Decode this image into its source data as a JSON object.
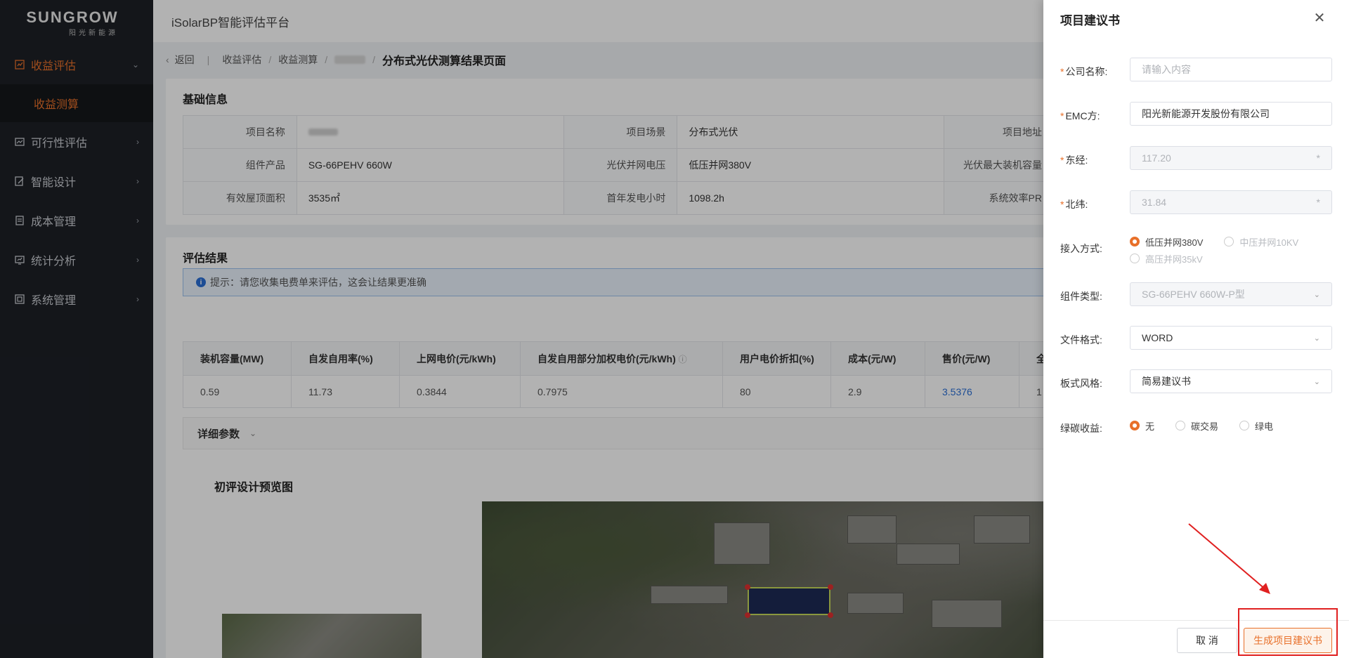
{
  "sidebar": {
    "logo_brand": "SUNGROW",
    "logo_sub": "阳光新能源",
    "items": [
      {
        "label": "收益评估",
        "icon": "chart-icon",
        "expanded": true
      },
      {
        "label": "可行性评估",
        "icon": "report-icon"
      },
      {
        "label": "智能设计",
        "icon": "design-icon"
      },
      {
        "label": "成本管理",
        "icon": "ledger-icon"
      },
      {
        "label": "统计分析",
        "icon": "stats-icon"
      },
      {
        "label": "系统管理",
        "icon": "settings-icon"
      }
    ],
    "active_subitem": "收益测算"
  },
  "topbar": {
    "title": "iSolarBP智能评估平台"
  },
  "breadcrumb": {
    "back": "返回",
    "path1": "收益评估",
    "path2": "收益测算",
    "current": "分布式光伏测算结果页面"
  },
  "basic_info": {
    "title": "基础信息",
    "rows": [
      [
        {
          "label": "项目名称",
          "value": ""
        },
        {
          "label": "项目场景",
          "value": "分布式光伏"
        },
        {
          "label": "项目地址",
          "value": ""
        }
      ],
      [
        {
          "label": "组件产品",
          "value": "SG-66PEHV 660W"
        },
        {
          "label": "光伏并网电压",
          "value": "低压并网380V"
        },
        {
          "label": "光伏最大装机容量",
          "value": ""
        }
      ],
      [
        {
          "label": "有效屋顶面积",
          "value": "3535㎡"
        },
        {
          "label": "首年发电小时",
          "value": "1098.2h"
        },
        {
          "label": "系统效率PR",
          "value": ""
        }
      ]
    ]
  },
  "evaluation": {
    "title": "评估结果",
    "tip": "提示：请您收集电费单来评估，这会让结果更准确",
    "headers": [
      "装机容量(MW)",
      "自发自用率(%)",
      "上网电价(元/kWh)",
      "自发自用部分加权电价(元/kWh)",
      "用户电价折扣(%)",
      "成本(元/W)",
      "售价(元/W)",
      "全"
    ],
    "values": [
      "0.59",
      "11.73",
      "0.3844",
      "0.7975",
      "80",
      "2.9",
      "3.5376",
      "1"
    ],
    "detail_label": "详细参数",
    "preview_title": "初评设计预览图"
  },
  "drawer": {
    "title": "项目建议书",
    "fields": {
      "company_label": "公司名称:",
      "company_placeholder": "请输入内容",
      "emc_label": "EMC方:",
      "emc_value": "阳光新能源开发股份有限公司",
      "lon_label": "东经:",
      "lon_value": "117.20",
      "lat_label": "北纬:",
      "lat_value": "31.84",
      "access_label": "接入方式:",
      "access_options": [
        "低压并网380V",
        "中压并网10KV",
        "高压并网35kV"
      ],
      "access_selected": "低压并网380V",
      "module_label": "组件类型:",
      "module_value": "SG-66PEHV 660W-P型",
      "format_label": "文件格式:",
      "format_value": "WORD",
      "style_label": "板式风格:",
      "style_value": "简易建议书",
      "carbon_label": "绿碳收益:",
      "carbon_options": [
        "无",
        "碳交易",
        "绿电"
      ],
      "carbon_selected": "无"
    },
    "cancel_label": "取 消",
    "generate_label": "生成项目建议书"
  },
  "colors": {
    "accent": "#e8702a",
    "sidebar_bg": "#1d2026",
    "link": "#2a6fd6",
    "annotation": "#e02020"
  }
}
